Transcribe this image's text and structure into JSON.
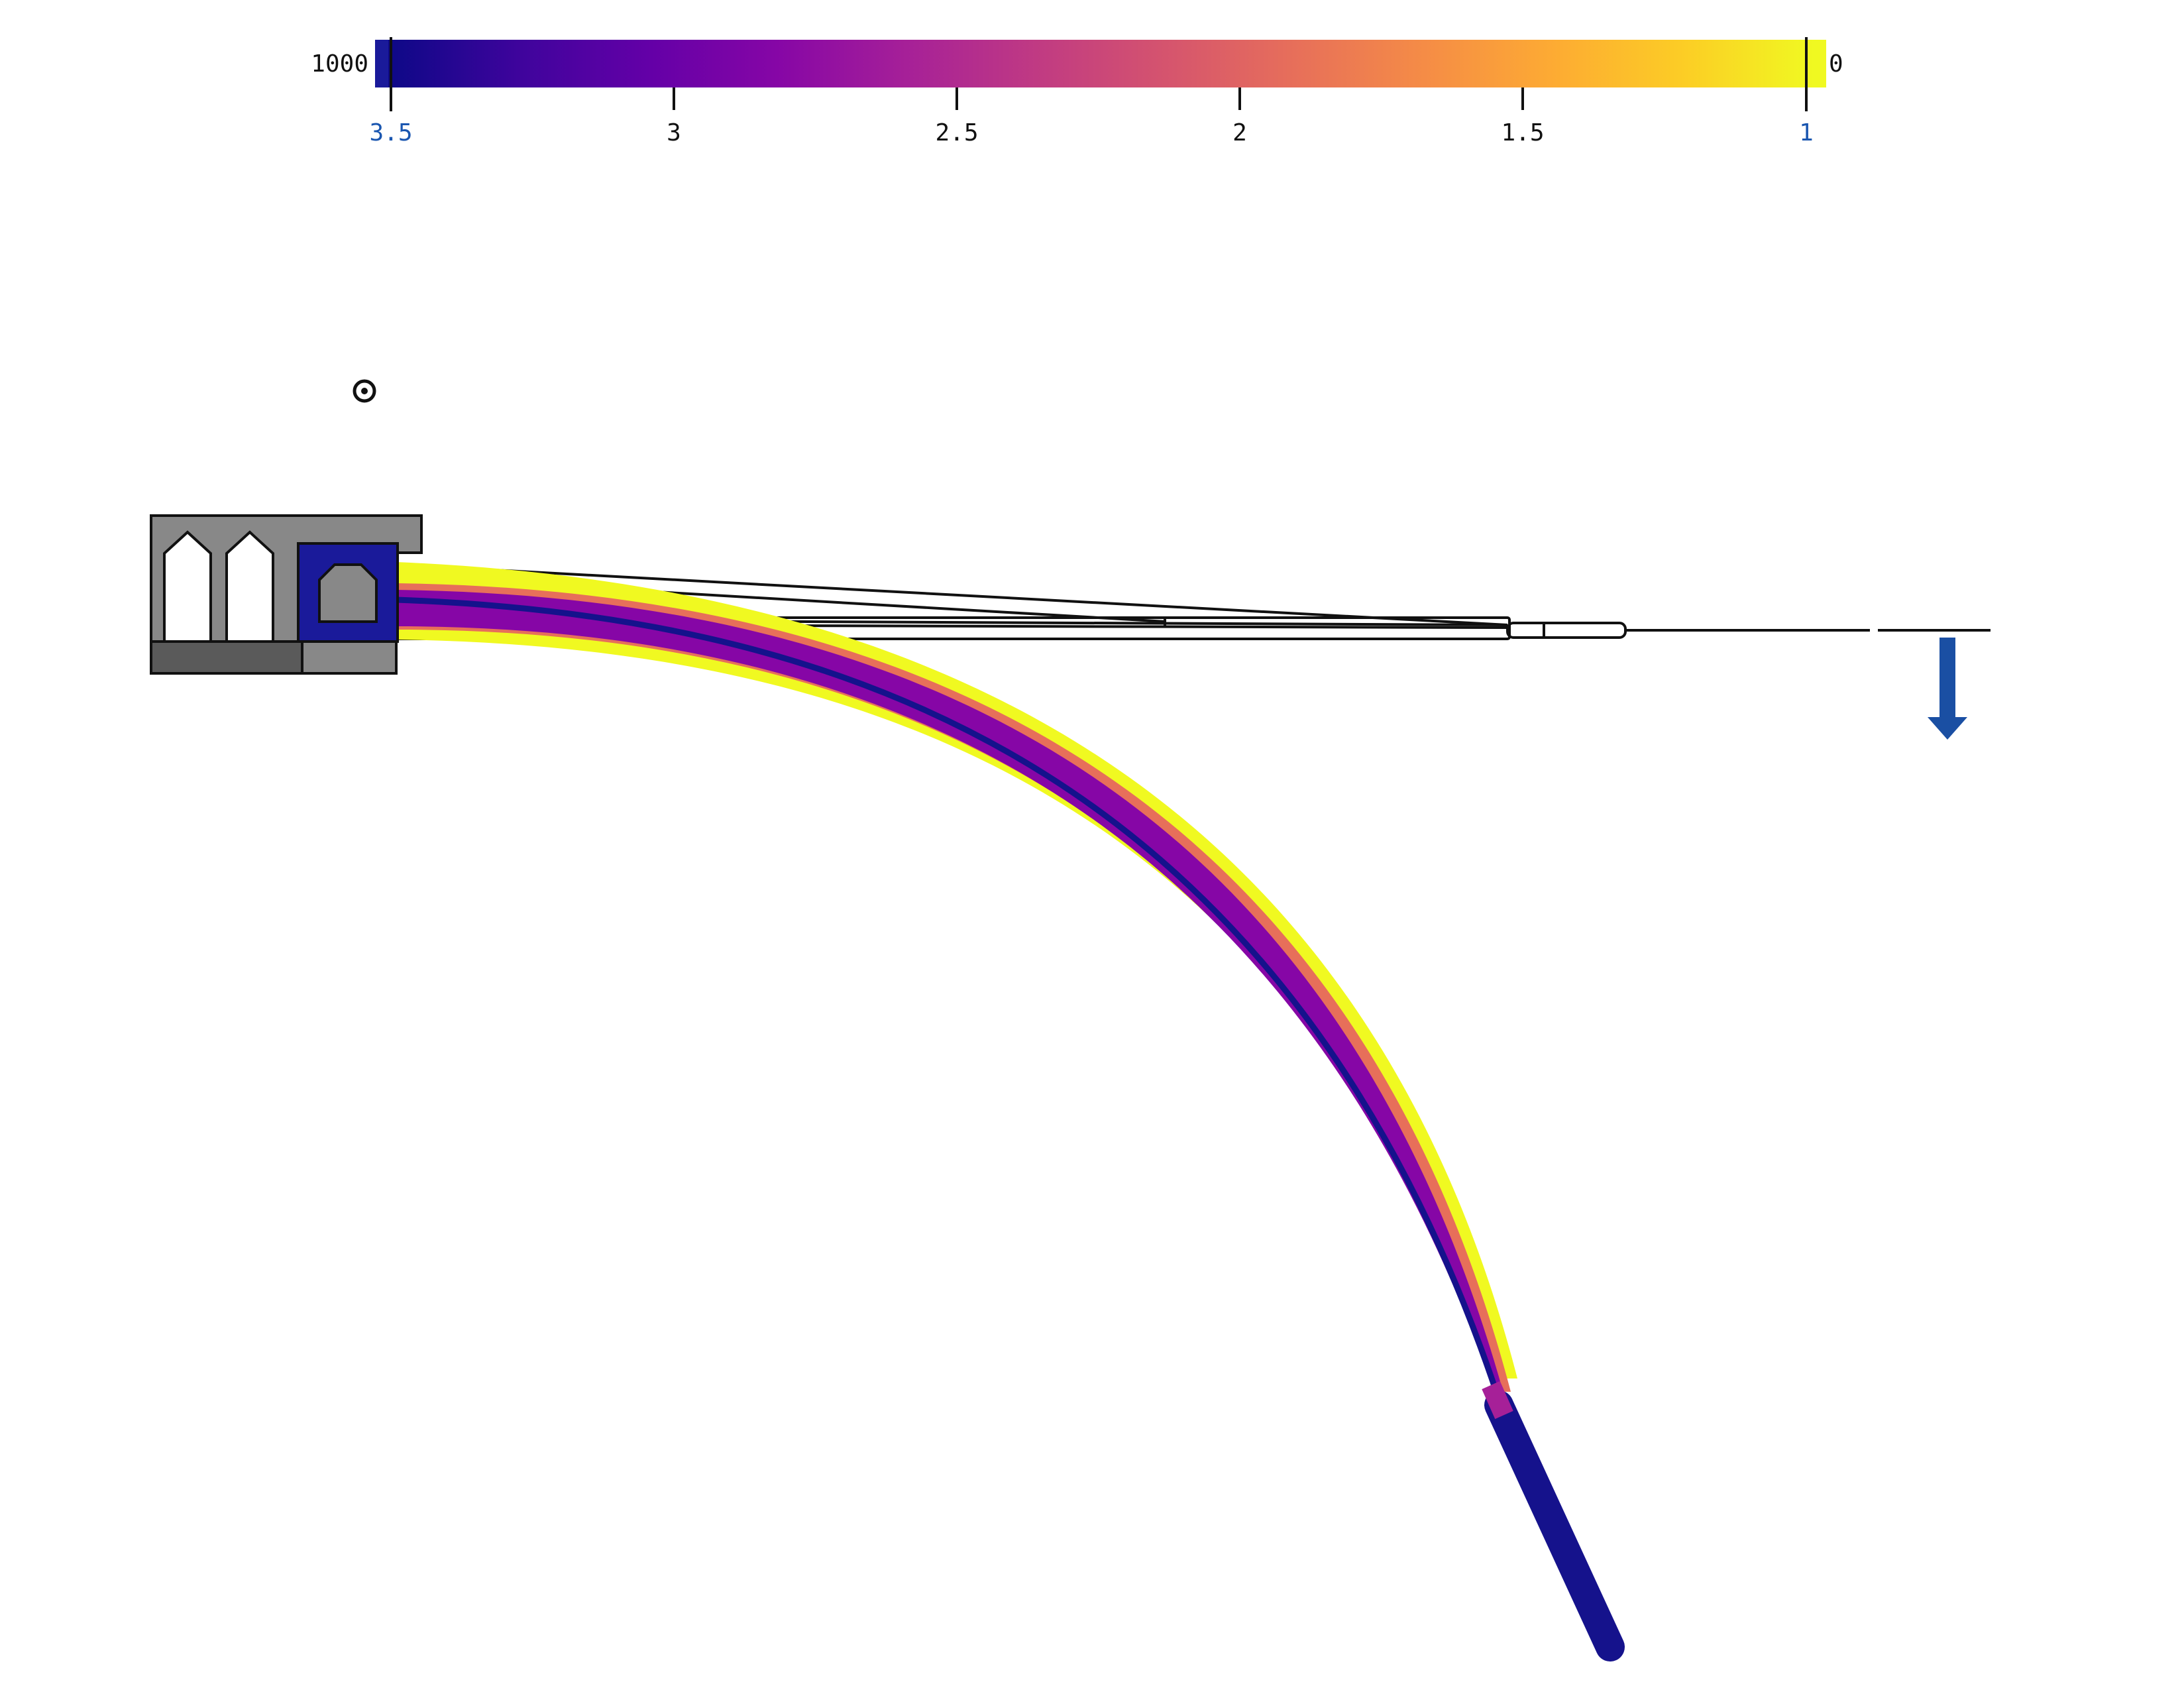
{
  "colorbar": {
    "left_label": "1000",
    "right_label": "0",
    "ticks": [
      "3.5",
      "3",
      "2.5",
      "2",
      "1.5",
      "1"
    ],
    "end_tick_color": "#1a56b0",
    "tick_color": "#111111",
    "stops": [
      "#0d0887",
      "#3e049c",
      "#6300a7",
      "#8606a6",
      "#a62098",
      "#c03a83",
      "#d5546e",
      "#e76f5a",
      "#f58c46",
      "#fdab33",
      "#fccd25",
      "#f0f921"
    ],
    "end_left_color": "#1a1a9a",
    "end_right_color": "#f0f921"
  },
  "colors": {
    "beam_low": "#f0f921",
    "beam_high": "#15128c",
    "beam_mid": "#a62098",
    "grip_gray": "#888888",
    "grip_dark": "#5a5a5a",
    "clamp_blue": "#1a1a9a",
    "arrow_blue": "#1a4fa3",
    "outline": "#111111"
  },
  "icons": {
    "out_of_plane": "circle-dot-icon",
    "load": "arrow-down-icon"
  }
}
